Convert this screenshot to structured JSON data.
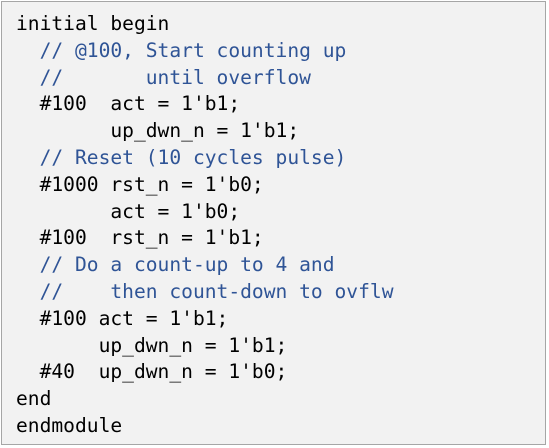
{
  "code_lines": [
    {
      "text": "initial begin",
      "kind": "code"
    },
    {
      "text": "  // @100, Start counting up",
      "kind": "comment"
    },
    {
      "text": "  //       until overflow",
      "kind": "comment"
    },
    {
      "text": "  #100  act = 1'b1;",
      "kind": "code"
    },
    {
      "text": "        up_dwn_n = 1'b1;",
      "kind": "code"
    },
    {
      "text": "  // Reset (10 cycles pulse)",
      "kind": "comment"
    },
    {
      "text": "  #1000 rst_n = 1'b0;",
      "kind": "code"
    },
    {
      "text": "        act = 1'b0;",
      "kind": "code"
    },
    {
      "text": "  #100  rst_n = 1'b1;",
      "kind": "code"
    },
    {
      "text": "  // Do a count-up to 4 and",
      "kind": "comment"
    },
    {
      "text": "  //    then count-down to ovflw",
      "kind": "comment"
    },
    {
      "text": "  #100 act = 1'b1;",
      "kind": "code"
    },
    {
      "text": "       up_dwn_n = 1'b1;",
      "kind": "code"
    },
    {
      "text": "  #40  up_dwn_n = 1'b0;",
      "kind": "code"
    },
    {
      "text": "end",
      "kind": "code"
    },
    {
      "text": "endmodule",
      "kind": "code"
    }
  ],
  "colors": {
    "background": "#f2f2f2",
    "border": "#a6a6a6",
    "code_text": "#000000",
    "comment_text": "#2f5496"
  }
}
